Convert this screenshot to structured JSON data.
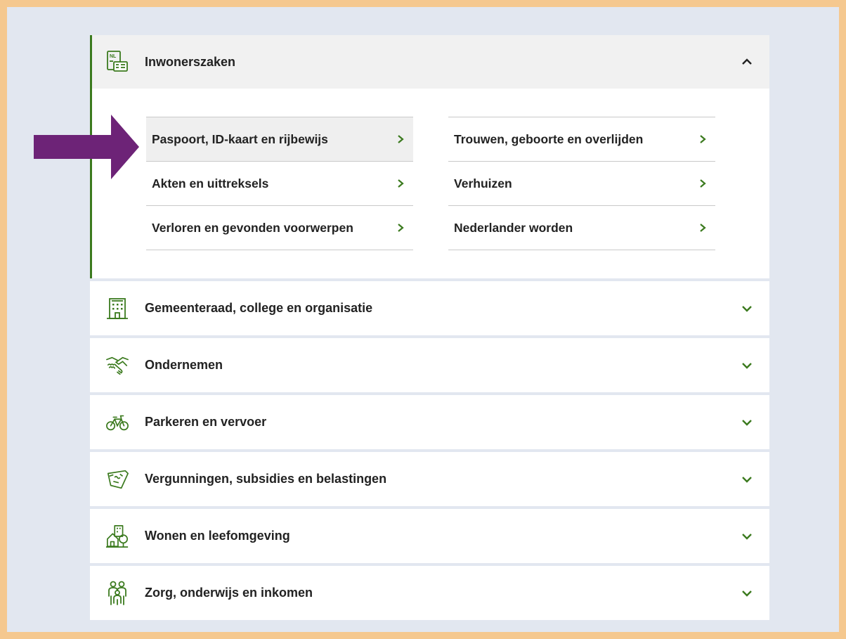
{
  "colors": {
    "accent": "#3b7a1e",
    "arrow": "#6d2377",
    "frame": "#f5c88f",
    "background": "#e2e7f0"
  },
  "accordion": {
    "open_section": {
      "title": "Inwonerszaken",
      "icon": "id-card-nl-icon",
      "column_1": [
        {
          "label": "Paspoort, ID-kaart en rijbewijs",
          "active": true
        },
        {
          "label": "Akten en uittreksels"
        },
        {
          "label": "Verloren en gevonden voorwerpen"
        }
      ],
      "column_2": [
        {
          "label": "Trouwen, geboorte en overlijden"
        },
        {
          "label": "Verhuizen"
        },
        {
          "label": "Nederlander worden"
        }
      ]
    },
    "sections": [
      {
        "title": "Gemeenteraad, college en organisatie",
        "icon": "building-icon"
      },
      {
        "title": "Ondernemen",
        "icon": "handshake-icon"
      },
      {
        "title": "Parkeren en vervoer",
        "icon": "bicycle-icon"
      },
      {
        "title": "Vergunningen, subsidies en belastingen",
        "icon": "permit-document-icon"
      },
      {
        "title": "Wonen en leefomgeving",
        "icon": "house-tree-icon"
      },
      {
        "title": "Zorg, onderwijs en inkomen",
        "icon": "family-icon"
      }
    ]
  }
}
